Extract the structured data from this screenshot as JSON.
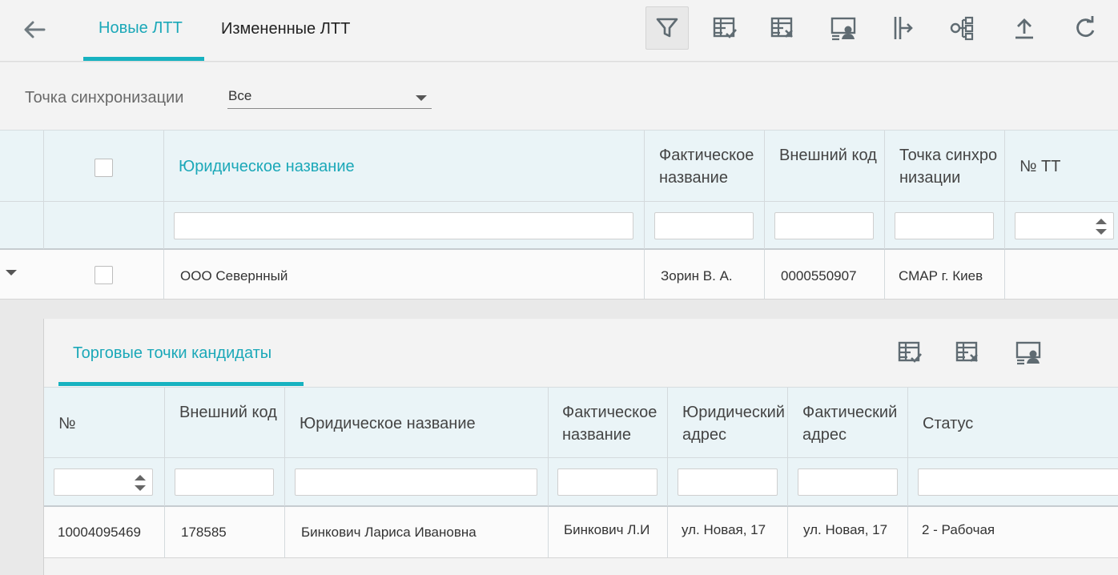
{
  "header": {
    "tabs": [
      {
        "label": "Новые ЛТТ",
        "active": true
      },
      {
        "label": "Измененные ЛТТ",
        "active": false
      }
    ],
    "toolbar": [
      "filter-icon",
      "grid-check-icon",
      "grid-clear-icon",
      "user-card-icon",
      "split-icon",
      "hierarchy-icon",
      "upload-icon",
      "refresh-icon"
    ]
  },
  "filter": {
    "label": "Точка синхронизации",
    "value": "Все"
  },
  "main_table": {
    "columns": [
      "Юридическое название",
      "Фактическое название",
      "Внешний код",
      "Точка синхронизации",
      "№ ТТ"
    ],
    "rows": [
      {
        "legal_name": "ООО Севернный",
        "actual_name": "Зорин В. А.",
        "ext_code": "0000550907",
        "sync_point": "СМАР г. Киев",
        "tt_no": ""
      }
    ]
  },
  "detail": {
    "tab_label": "Торговые точки кандидаты",
    "toolbar": [
      "grid-check-icon",
      "grid-clear-icon",
      "user-card-icon"
    ],
    "columns": [
      "№",
      "Внешний код",
      "Юридическое название",
      "Фактическое название",
      "Юридический адрес",
      "Фактический адрес",
      "Статус"
    ],
    "rows": [
      {
        "no": "10004095469",
        "ext_code": "178585",
        "legal_name": "Бинкович Лариса Ивановна",
        "actual_name": "Бинкович Л.И",
        "legal_address": "ул. Новая, 17",
        "actual_address": "ул. Новая, 17",
        "status": "2 - Рабочая"
      }
    ]
  },
  "colors": {
    "accent": "#17b2c0",
    "header_bg": "#eaf4f7",
    "panel_bg": "#f3f3f3"
  }
}
